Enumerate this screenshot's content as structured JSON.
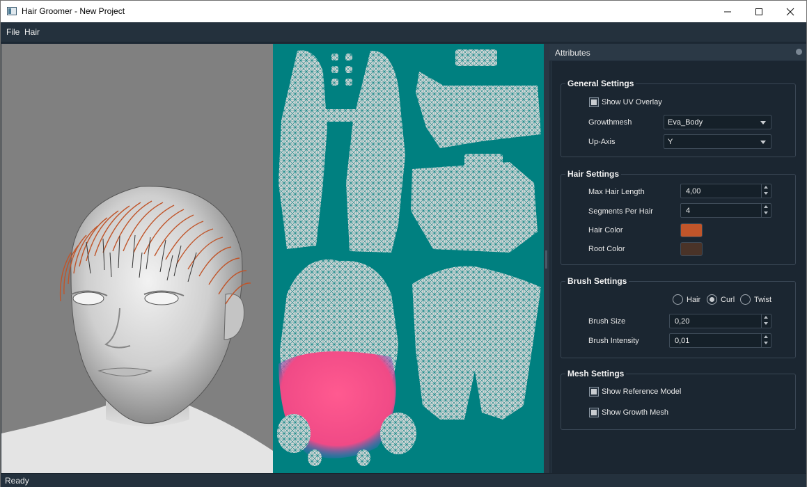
{
  "window": {
    "title": "Hair Groomer - New Project"
  },
  "menu": {
    "items": [
      "File",
      "Hair"
    ]
  },
  "attributes": {
    "title": "Attributes",
    "general": {
      "title": "General Settings",
      "show_uv_overlay": {
        "label": "Show UV Overlay",
        "checked": true
      },
      "growthmesh": {
        "label": "Growthmesh",
        "value": "Eva_Body"
      },
      "up_axis": {
        "label": "Up-Axis",
        "value": "Y"
      }
    },
    "hair": {
      "title": "Hair Settings",
      "max_hair_length": {
        "label": "Max Hair Length",
        "value": "4,00"
      },
      "segments_per_hair": {
        "label": "Segments Per Hair",
        "value": "4"
      },
      "hair_color": {
        "label": "Hair Color",
        "color": "#c0552a"
      },
      "root_color": {
        "label": "Root Color",
        "color": "#4a3328"
      }
    },
    "brush": {
      "title": "Brush Settings",
      "modes": [
        {
          "label": "Hair",
          "checked": false
        },
        {
          "label": "Curl",
          "checked": true
        },
        {
          "label": "Twist",
          "checked": false
        }
      ],
      "brush_size": {
        "label": "Brush Size",
        "value": "0,20"
      },
      "brush_intensity": {
        "label": "Brush Intensity",
        "value": "0,01"
      }
    },
    "mesh": {
      "title": "Mesh Settings",
      "show_reference_model": {
        "label": "Show Reference Model",
        "checked": true
      },
      "show_growth_mesh": {
        "label": "Show Growth Mesh",
        "checked": true
      }
    }
  },
  "status": {
    "text": "Ready"
  },
  "colors": {
    "viewport_bg": "#808080",
    "uv_bg": "#008080",
    "panel_bg": "#1b2631",
    "hair_orange": "#c0552a",
    "brush_pink": "#ff4a8a"
  },
  "icons": {
    "app": "app-icon",
    "minimize": "minimize-icon",
    "maximize": "maximize-icon",
    "close": "close-icon",
    "float": "dock-float-icon"
  }
}
